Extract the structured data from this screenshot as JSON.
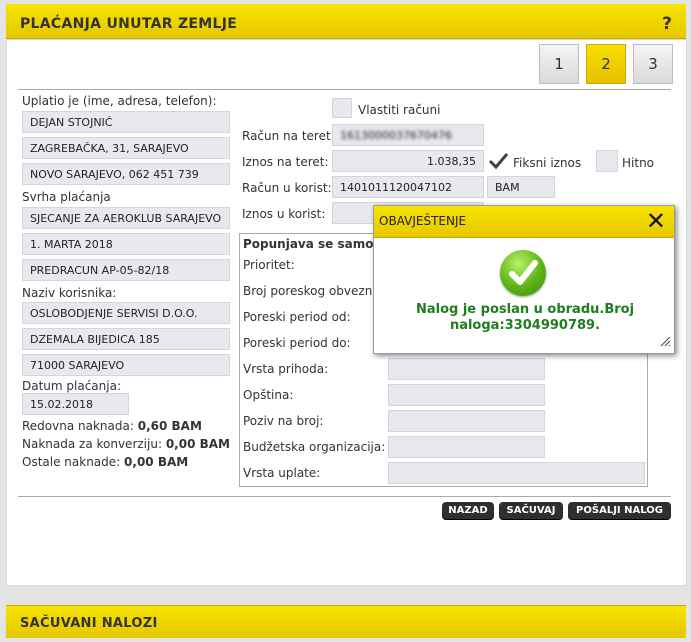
{
  "header": {
    "title": "PLAĆANJA UNUTAR ZEMLJE",
    "help": "?"
  },
  "steps": [
    "1",
    "2",
    "3"
  ],
  "payer": {
    "label": "Uplatio je (ime, adresa, telefon):",
    "lines": [
      "DEJAN STOJNIĆ",
      "ZAGREBAČKA, 31, SARAJEVO",
      "NOVO SARAJEVO, 062 451 739"
    ]
  },
  "purpose": {
    "label": "Svrha plaćanja",
    "lines": [
      "SJECANJE ZA AEROKLUB SARAJEVO",
      "1. MARTA 2018",
      "PREDRACUN AP-05-82/18"
    ]
  },
  "recipient": {
    "label": "Naziv korisnika:",
    "lines": [
      "OSLOBODJENJE SERVISI D.O.O.",
      "DZEMALA BIJEDICA 185",
      "71000 SARAJEVO"
    ]
  },
  "payment_date": {
    "label": "Datum plaćanja:",
    "value": "15.02.2018"
  },
  "fees": {
    "regular_label": "Redovna naknada:",
    "regular_value": "0,60 BAM",
    "conversion_label": "Naknada za konverziju:",
    "conversion_value": "0,00 BAM",
    "other_label": "Ostale naknade:",
    "other_value": "0,00 BAM"
  },
  "own_accounts_label": "Vlastiti računi",
  "debit_account": {
    "label": "Račun na teret:",
    "value": "1613000037670476"
  },
  "debit_amount": {
    "label": "Iznos na teret:",
    "value": "1.038,35"
  },
  "fixed_amount_label": "Fiksni iznos",
  "urgent_label": "Hitno",
  "credit_account": {
    "label": "Račun u korist:",
    "value": "1401011120047102",
    "currency": "BAM"
  },
  "credit_amount": {
    "label": "Iznos u korist:"
  },
  "tax_section": {
    "title": "Popunjava se samo u",
    "priority": "Prioritet:",
    "tax_number": "Broj poreskog obveznika",
    "period_from": "Poreski period od:",
    "period_to": "Poreski period do:",
    "income_type": "Vrsta prihoda:",
    "municipality": "Opština:",
    "reference": "Poziv na broj:",
    "budget_org": "Budžetska organizacija:",
    "payment_type": "Vrsta uplate:"
  },
  "buttons": {
    "back": "NAZAD",
    "save": "SAČUVAJ",
    "send": "POŠALJI NALOG"
  },
  "modal": {
    "title": "OBAVJEŠTENJE",
    "close": "✕",
    "message_line1": "Nalog je poslan u obradu.Broj",
    "message_line2": "naloga:3304990789."
  },
  "saved_orders": {
    "title": "SAČUVANI NALOZI"
  },
  "colors": {
    "accent": "#f2d800",
    "success": "#1f7d1f",
    "button": "#2f2f2f"
  }
}
